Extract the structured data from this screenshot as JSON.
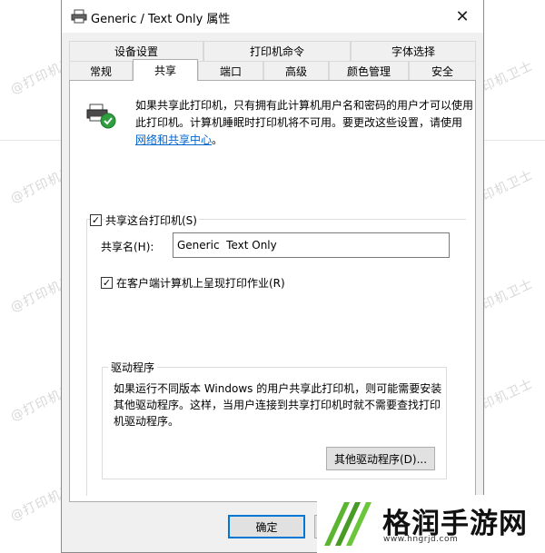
{
  "window": {
    "title": "Generic / Text Only 属性",
    "close_glyph": "✕"
  },
  "tabs_row1": [
    {
      "label": "设备设置"
    },
    {
      "label": "打印机命令"
    },
    {
      "label": "字体选择"
    }
  ],
  "tabs_row2": [
    {
      "label": "常规"
    },
    {
      "label": "共享"
    },
    {
      "label": "端口"
    },
    {
      "label": "高级"
    },
    {
      "label": "颜色管理"
    },
    {
      "label": "安全"
    }
  ],
  "active_tab": "共享",
  "share": {
    "intro_text": "如果共享此打印机，只有拥有此计算机用户名和密码的用户才可以使用此打印机。计算机睡眠时打印机将不可用。要更改这些设置，请使用",
    "intro_link": "网络和共享中心",
    "intro_end": "。",
    "share_checkbox_label": "共享这台打印机(S)",
    "share_checkbox_checked": true,
    "share_name_label": "共享名(H):",
    "share_name_value": "Generic  Text Only",
    "render_checkbox_label": "在客户端计算机上呈现打印作业(R)",
    "render_checkbox_checked": true
  },
  "drivers": {
    "title": "驱动程序",
    "text": "如果运行不同版本 Windows 的用户共享此打印机，则可能需要安装其他驱动程序。这样，当用户连接到共享打印机时就不需要查找打印机驱动程序。",
    "other_drivers_button": "其他驱动程序(D)..."
  },
  "footer": {
    "ok_label": "确定",
    "cancel_label": ""
  },
  "watermark": {
    "text": "@打印机卫士"
  },
  "brand": {
    "name": "格润手游网",
    "url": "www.hngrjd.com"
  },
  "colors": {
    "link": "#0066cc",
    "accent": "#0078d7",
    "brand_green": "#5cb531"
  }
}
